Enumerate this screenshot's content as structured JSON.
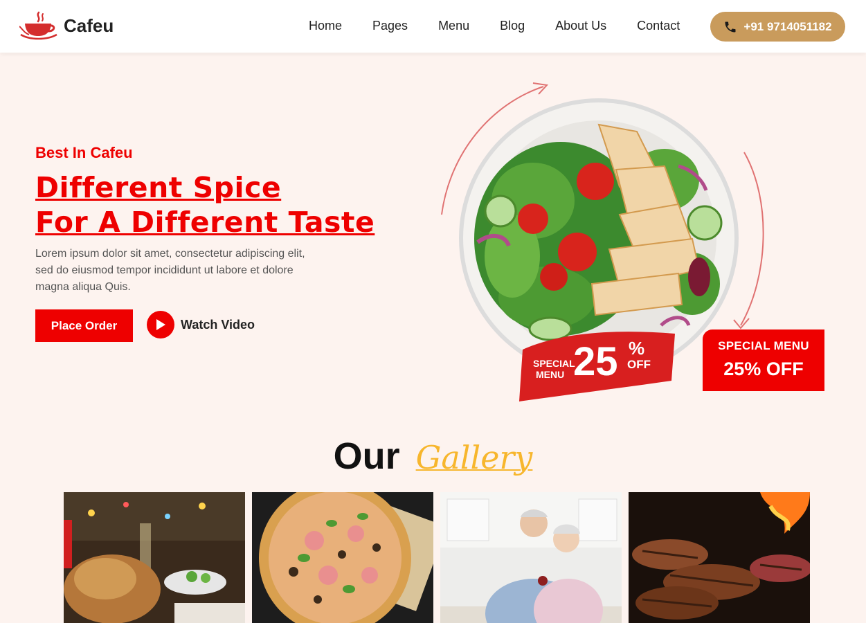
{
  "brand": {
    "name": "Cafeu",
    "logo_icon": "coffee-cup-icon"
  },
  "nav": {
    "items": [
      {
        "label": "Home"
      },
      {
        "label": "Pages"
      },
      {
        "label": "Menu"
      },
      {
        "label": "Blog"
      },
      {
        "label": "About Us"
      },
      {
        "label": "Contact"
      }
    ],
    "phone": "+91 9714051182",
    "phone_icon": "phone-icon"
  },
  "hero": {
    "eyebrow": "Best In Cafeu",
    "title_line1": "Different Spice",
    "title_line2": "For A Different Taste",
    "description": "Lorem ipsum dolor sit amet, consectetur adipiscing elit, sed do eiusmod tempor incididunt ut labore et dolore magna aliqua Quis.",
    "order_button": "Place Order",
    "watch_label": "Watch Video",
    "badge_left": "SPECIAL",
    "badge_left2": "MENU",
    "badge_value": "25",
    "badge_pct": "%",
    "badge_off": "OFF",
    "special_line1": "SPECIAL MENU",
    "special_line2": "25% OFF"
  },
  "gallery": {
    "title": "Our",
    "title_accent": "Gallery",
    "items": [
      {
        "name": "roast-chicken-image"
      },
      {
        "name": "pizza-image"
      },
      {
        "name": "couple-kitchen-image"
      },
      {
        "name": "grilled-steak-image"
      }
    ]
  },
  "colors": {
    "accent_red": "#ee0000",
    "gold": "#c99b5c",
    "gallery_yellow": "#f7b62d",
    "bg": "#fdf3ef"
  }
}
